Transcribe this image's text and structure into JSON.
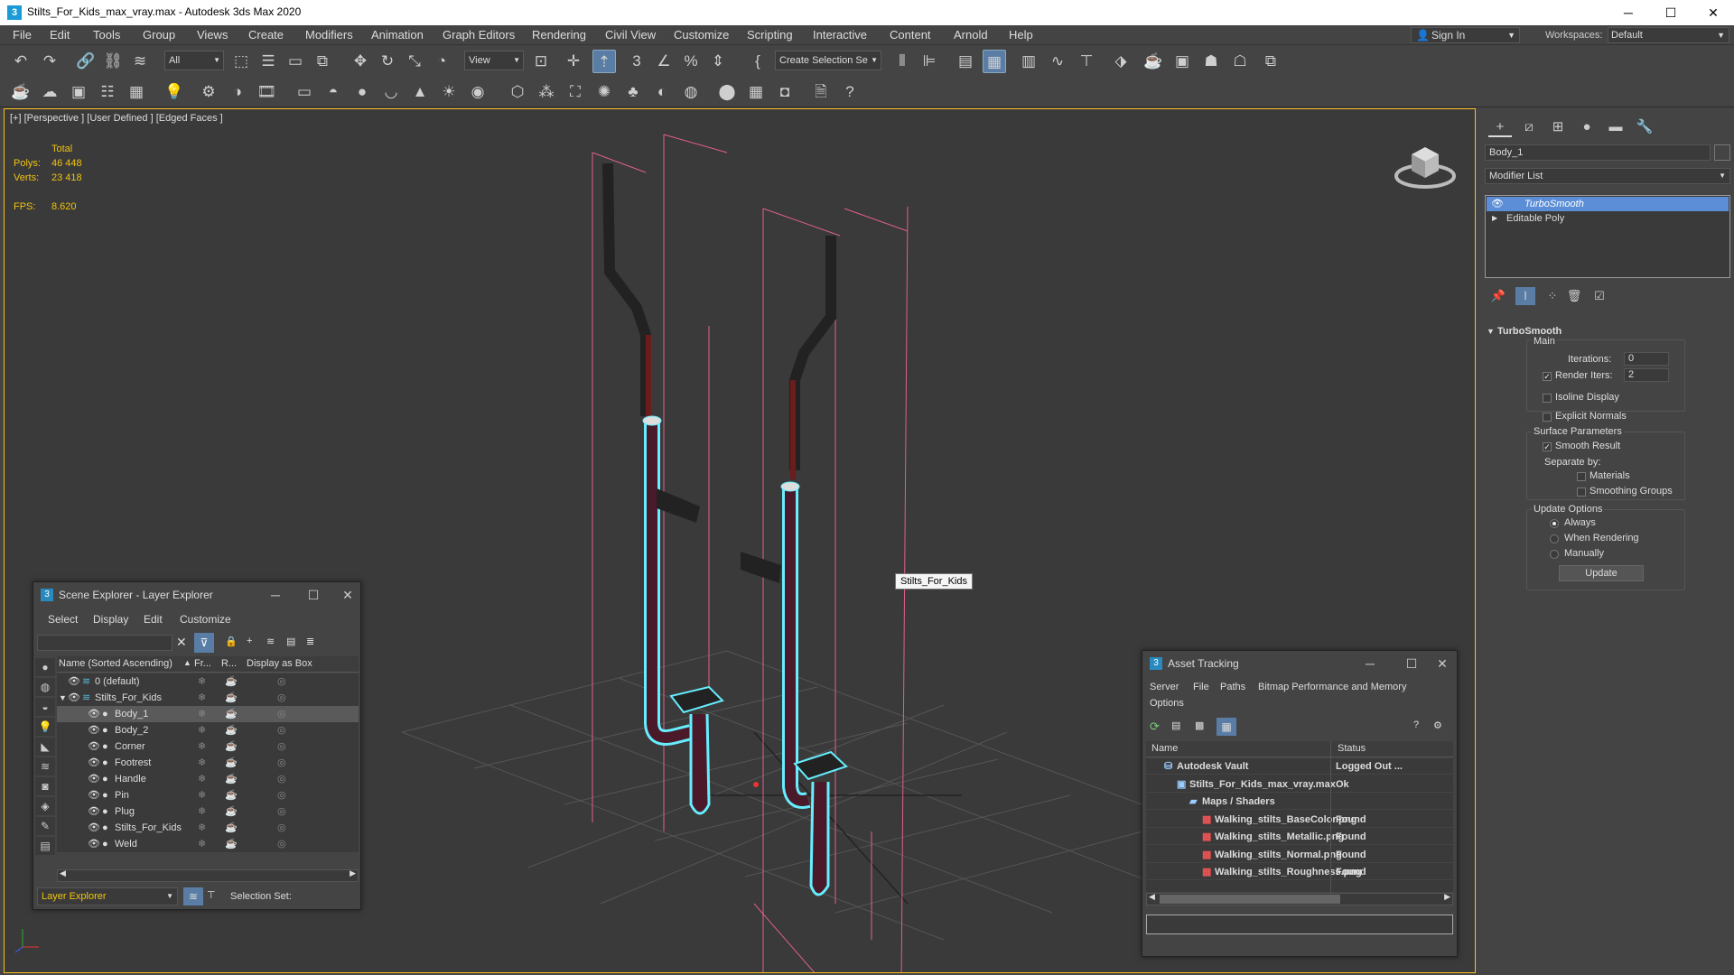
{
  "window": {
    "title": "Stilts_For_Kids_max_vray.max - Autodesk 3ds Max 2020",
    "minimize": "─",
    "maximize": "☐",
    "close": "✕"
  },
  "menu": [
    "File",
    "Edit",
    "Tools",
    "Group",
    "Views",
    "Create",
    "Modifiers",
    "Animation",
    "Graph Editors",
    "Rendering",
    "Civil View",
    "Customize",
    "Scripting",
    "Interactive",
    "Content",
    "Arnold",
    "Help"
  ],
  "signin": "Sign In",
  "workspace": {
    "label": "Workspaces:",
    "value": "Default"
  },
  "toolbar": {
    "filter_value": "All",
    "view_value": "View",
    "selection_set": "Create Selection Se"
  },
  "viewport": {
    "label": "[+] [Perspective ] [User Defined ] [Edged Faces ]",
    "stats": {
      "total_label": "Total",
      "polys_label": "Polys:",
      "polys": "46 448",
      "verts_label": "Verts:",
      "verts": "23 418",
      "fps_label": "FPS:",
      "fps": "8.620"
    },
    "tooltip": "Stilts_For_Kids"
  },
  "command_panel": {
    "object_name": "Body_1",
    "modifier_list": "Modifier List",
    "stack": [
      "TurboSmooth",
      "Editable Poly"
    ],
    "rollout_title": "TurboSmooth",
    "main_label": "Main",
    "iterations_label": "Iterations:",
    "iterations": "0",
    "render_iters_label": "Render Iters:",
    "render_iters": "2",
    "isoline": "Isoline Display",
    "explicit_normals": "Explicit Normals",
    "surface_params": "Surface Parameters",
    "smooth_result": "Smooth Result",
    "separate_by": "Separate by:",
    "materials": "Materials",
    "smoothing_groups": "Smoothing Groups",
    "update_options": "Update Options",
    "always": "Always",
    "when_rendering": "When Rendering",
    "manually": "Manually",
    "update_button": "Update"
  },
  "scene_explorer": {
    "title": "Scene Explorer - Layer Explorer",
    "menu": [
      "Select",
      "Display",
      "Edit",
      "Customize"
    ],
    "columns": [
      "Name (Sorted Ascending)",
      "Fr...",
      "R...",
      "Display as Box"
    ],
    "rows": [
      {
        "name": "0 (default)",
        "indent": 0
      },
      {
        "name": "Stilts_For_Kids",
        "indent": 0
      },
      {
        "name": "Body_1",
        "indent": 1
      },
      {
        "name": "Body_2",
        "indent": 1
      },
      {
        "name": "Corner",
        "indent": 1
      },
      {
        "name": "Footrest",
        "indent": 1
      },
      {
        "name": "Handle",
        "indent": 1
      },
      {
        "name": "Pin",
        "indent": 1
      },
      {
        "name": "Plug",
        "indent": 1
      },
      {
        "name": "Stilts_For_Kids",
        "indent": 1
      },
      {
        "name": "Weld",
        "indent": 1
      }
    ],
    "footer_dropdown": "Layer Explorer",
    "selection_set_label": "Selection Set:"
  },
  "asset_tracking": {
    "title": "Asset Tracking",
    "menu": [
      "Server",
      "File",
      "Paths",
      "Bitmap Performance and Memory",
      "Options"
    ],
    "columns": [
      "Name",
      "Status"
    ],
    "rows": [
      {
        "name": "Autodesk Vault",
        "status": "Logged Out ..."
      },
      {
        "name": "Stilts_For_Kids_max_vray.max",
        "status": "Ok"
      },
      {
        "name": "Maps / Shaders",
        "status": ""
      },
      {
        "name": "Walking_stilts_BaseColor.png",
        "status": "Found"
      },
      {
        "name": "Walking_stilts_Metallic.png",
        "status": "Found"
      },
      {
        "name": "Walking_stilts_Normal.png",
        "status": "Found"
      },
      {
        "name": "Walking_stilts_Roughness.png",
        "status": "Found"
      }
    ]
  }
}
